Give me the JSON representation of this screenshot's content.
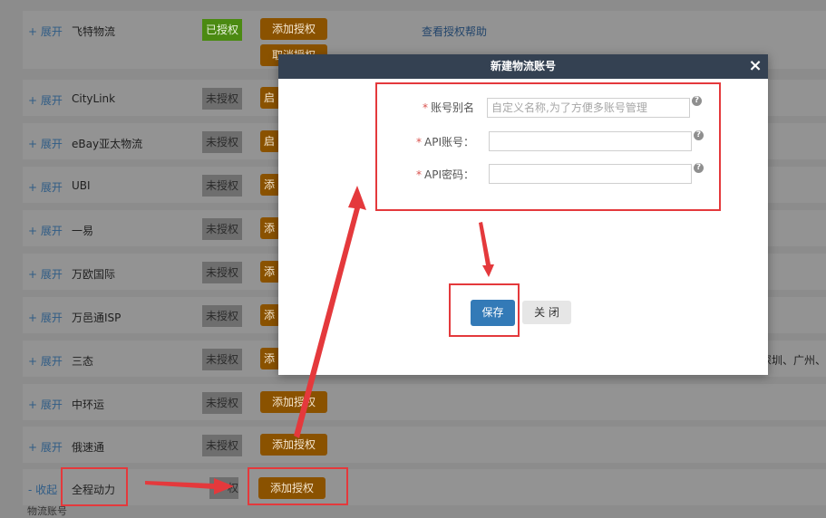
{
  "background": {
    "rows": [
      {
        "toggle": "+ 展开",
        "name": "飞特物流",
        "status": "已授权",
        "authorized": true,
        "action": "添加授权",
        "action2": "取消授权",
        "help": "查看授权帮助"
      },
      {
        "toggle": "+ 展开",
        "name": "CityLink",
        "status": "未授权",
        "authorized": false,
        "action": "启"
      },
      {
        "toggle": "+ 展开",
        "name": "eBay亚太物流",
        "status": "未授权",
        "authorized": false,
        "action": "启"
      },
      {
        "toggle": "+ 展开",
        "name": "UBI",
        "status": "未授权",
        "authorized": false,
        "action": "添"
      },
      {
        "toggle": "+ 展开",
        "name": "一易",
        "status": "未授权",
        "authorized": false,
        "action": "添"
      },
      {
        "toggle": "+ 展开",
        "name": "万欧国际",
        "status": "未授权",
        "authorized": false,
        "action": "添"
      },
      {
        "toggle": "+ 展开",
        "name": "万邑通ISP",
        "status": "未授权",
        "authorized": false,
        "action": "添"
      },
      {
        "toggle": "+ 展开",
        "name": "三态",
        "status": "未授权",
        "authorized": false,
        "action": "添"
      },
      {
        "toggle": "+ 展开",
        "name": "中环运",
        "status": "未授权",
        "authorized": false,
        "action": "添加授权"
      },
      {
        "toggle": "+ 展开",
        "name": "俄速通",
        "status": "未授权",
        "authorized": false,
        "action": "添加授权"
      },
      {
        "toggle": "- 收起",
        "name": "全程动力",
        "status": "权",
        "authorized": false,
        "action": "添加授权"
      }
    ],
    "side_text": "深圳、广州、",
    "footer_fragment": "物流账号"
  },
  "modal": {
    "title": "新建物流账号",
    "close_glyph": "×",
    "fields": [
      {
        "label": "账号别名",
        "value": "",
        "placeholder": "自定义名称,为了方便多账号管理"
      },
      {
        "label": "API账号：",
        "value": "",
        "placeholder": ""
      },
      {
        "label": "API密码：",
        "value": "",
        "placeholder": ""
      }
    ],
    "required_mark": "*",
    "help_glyph": "?",
    "save_label": "保存",
    "close_label": "关 闭"
  },
  "colors": {
    "header": "#344152",
    "primary": "#337ab7",
    "annotation": "#e4393c",
    "authorized": "#4b8a12",
    "action": "#8a5200"
  }
}
